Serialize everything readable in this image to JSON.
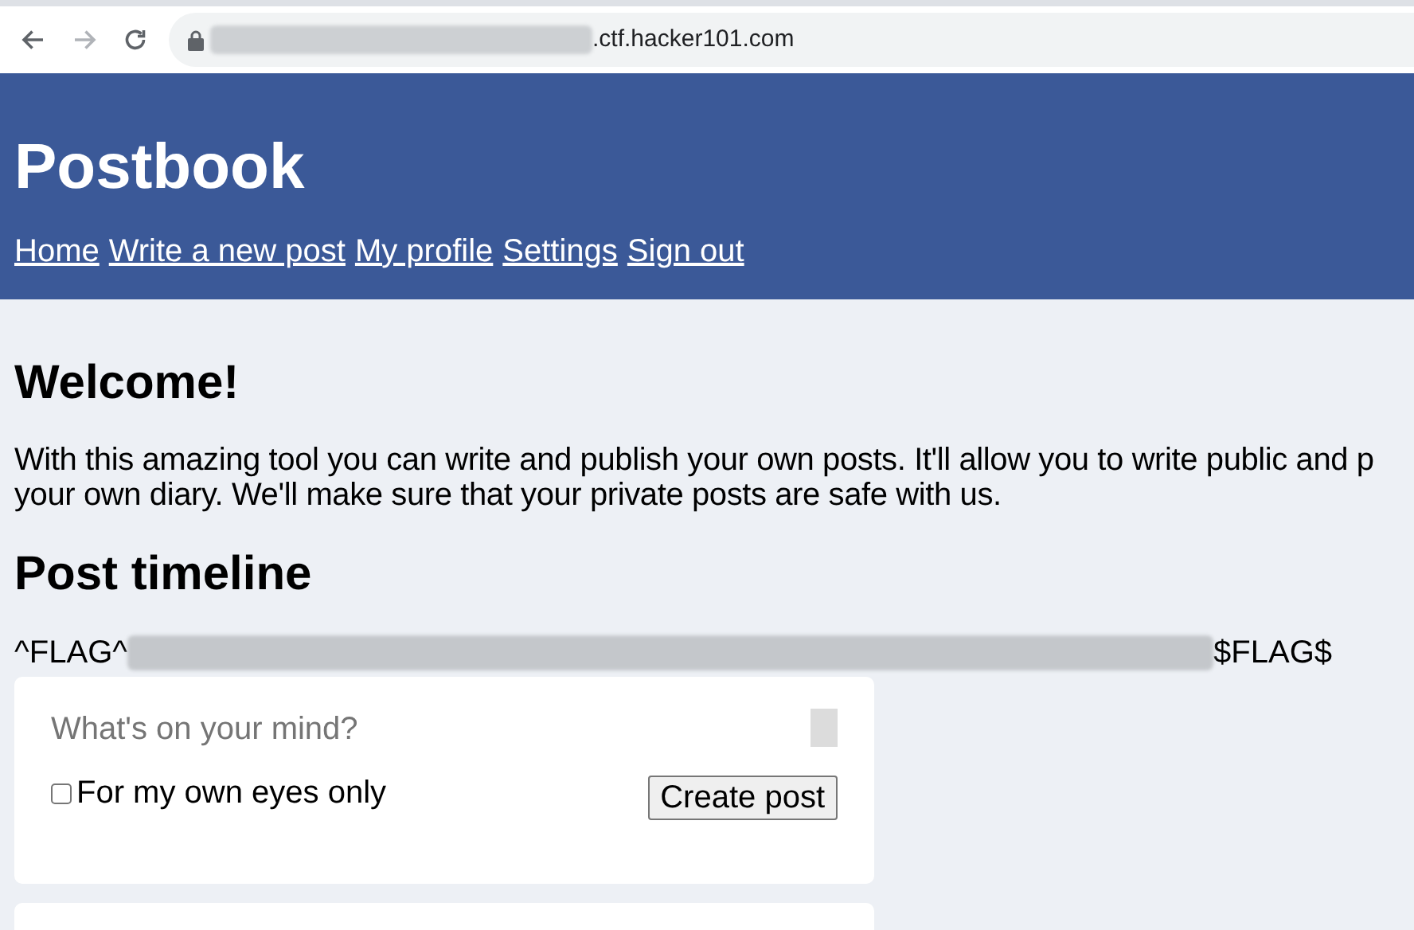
{
  "browser": {
    "url_visible": ".ctf.hacker101.com"
  },
  "header": {
    "title": "Postbook",
    "nav": [
      "Home",
      "Write a new post",
      "My profile",
      "Settings",
      "Sign out"
    ]
  },
  "welcome": {
    "heading": "Welcome!",
    "lines": [
      "With this amazing tool you can write and publish your own posts. It'll allow you to write public and p",
      "your own diary. We'll make sure that your private posts are safe with us."
    ]
  },
  "timeline": {
    "heading": "Post timeline",
    "flag_start": "^FLAG^",
    "flag_end": "$FLAG$"
  },
  "post_form": {
    "placeholder": "What's on your mind?",
    "private": {
      "label": "For my own eyes only",
      "checked": false
    },
    "button": "Create post"
  }
}
